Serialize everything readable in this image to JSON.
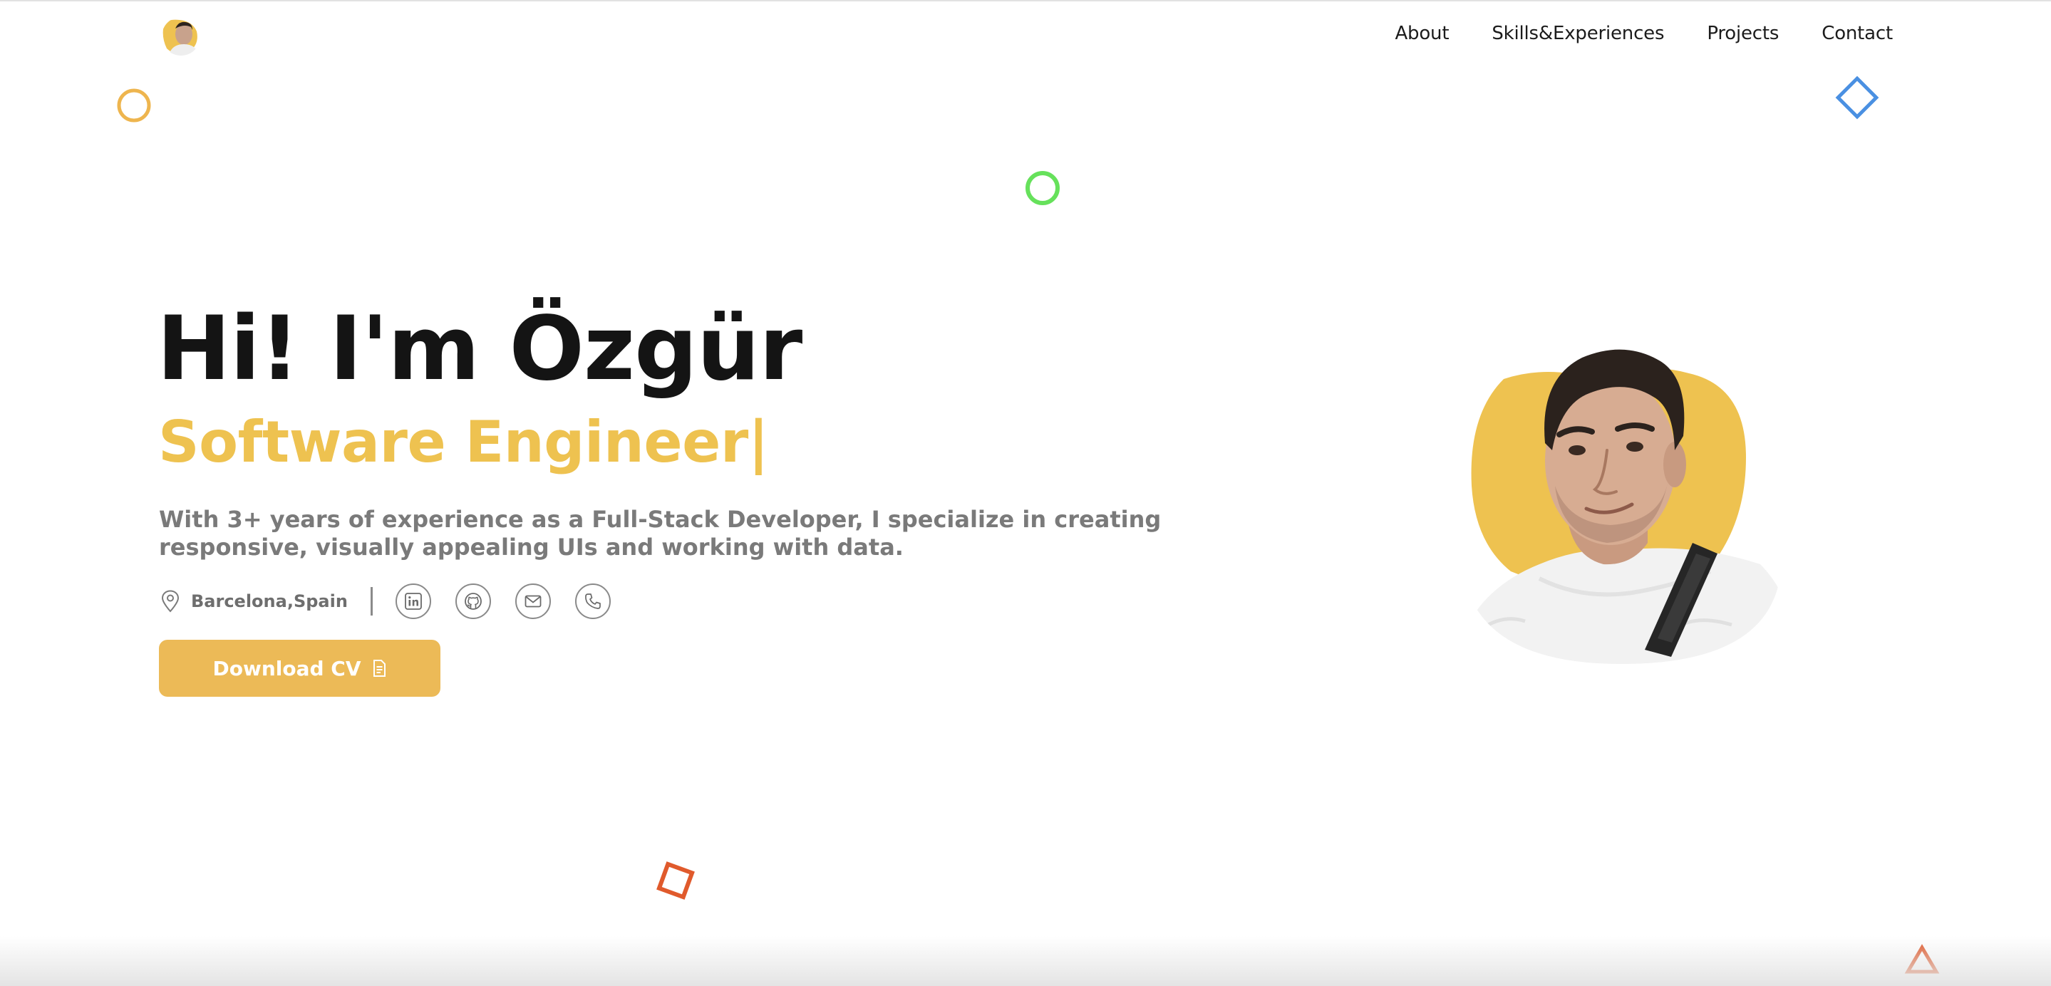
{
  "nav": {
    "items": [
      {
        "label": "About"
      },
      {
        "label": "Skills&Experiences"
      },
      {
        "label": "Projects"
      },
      {
        "label": "Contact"
      }
    ]
  },
  "hero": {
    "title": "Hi! I'm Özgür",
    "role": "Software Engineer|",
    "description": "With 3+ years of experience as a Full-Stack Developer, I specialize in creating responsive, visually appealing UIs and working with data.",
    "location": "Barcelona,Spain",
    "cv_button_label": "Download CV"
  },
  "socials": [
    {
      "icon": "linkedin-icon"
    },
    {
      "icon": "github-icon"
    },
    {
      "icon": "mail-icon"
    },
    {
      "icon": "phone-icon"
    }
  ],
  "colors": {
    "accent": "#eec250",
    "button": "#ecba57",
    "deco_orange": "#eeb54e",
    "deco_green": "#66e15b",
    "deco_blue": "#4a90e2",
    "deco_red": "#e05a2c"
  }
}
